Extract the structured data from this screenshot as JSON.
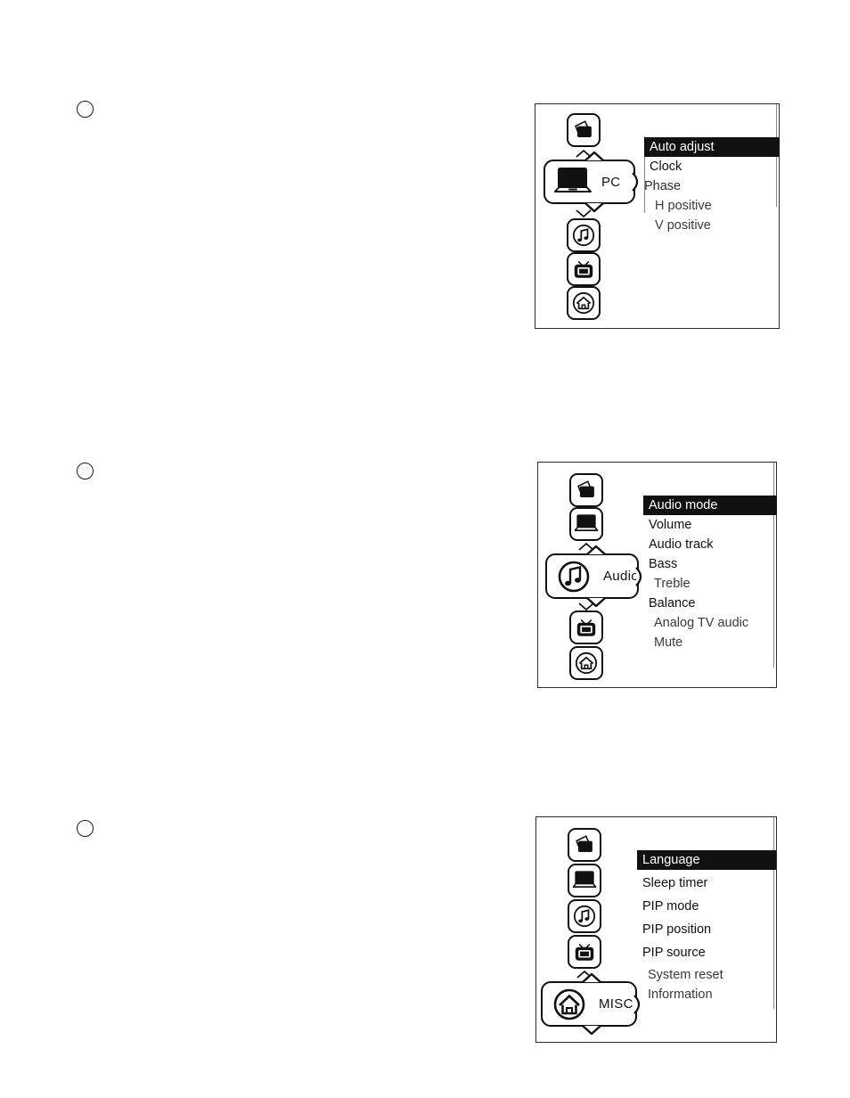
{
  "page": {
    "background_color": "#ffffff",
    "ink_color": "#111111",
    "highlight_bg": "#111111",
    "highlight_fg": "#ffffff"
  },
  "bullets": [
    {
      "name": "step-bullet-1"
    },
    {
      "name": "step-bullet-2"
    },
    {
      "name": "step-bullet-3"
    }
  ],
  "panels": [
    {
      "id": "pc-menu",
      "selected_category": "PC",
      "selected_icon": "laptop-icon",
      "rail_icons": [
        {
          "icon": "picture-icon",
          "label": "Picture"
        },
        {
          "icon": "music-note-icon",
          "label": "Audio"
        },
        {
          "icon": "tv-icon",
          "label": "TV"
        },
        {
          "icon": "home-icon",
          "label": "MISC"
        }
      ],
      "items": [
        {
          "label": "Auto adjust",
          "selected": true,
          "indent": false
        },
        {
          "label": "Clock",
          "selected": false,
          "indent": false
        },
        {
          "label": "Phase",
          "selected": false,
          "indent": false
        },
        {
          "label": "H positive",
          "selected": false,
          "indent": true
        },
        {
          "label": "V positive",
          "selected": false,
          "indent": true
        }
      ]
    },
    {
      "id": "audio-menu",
      "selected_category": "Audio",
      "selected_icon": "music-note-icon",
      "rail_icons": [
        {
          "icon": "picture-icon",
          "label": "Picture"
        },
        {
          "icon": "laptop-icon",
          "label": "PC"
        },
        {
          "icon": "tv-icon",
          "label": "TV"
        },
        {
          "icon": "home-icon",
          "label": "MISC"
        }
      ],
      "items": [
        {
          "label": "Audio mode",
          "selected": true,
          "indent": false
        },
        {
          "label": "Volume",
          "selected": false,
          "indent": false
        },
        {
          "label": "Audio track",
          "selected": false,
          "indent": false
        },
        {
          "label": "Bass",
          "selected": false,
          "indent": false
        },
        {
          "label": "Treble",
          "selected": false,
          "indent": true
        },
        {
          "label": "Balance",
          "selected": false,
          "indent": false
        },
        {
          "label": "Analog TV audic",
          "selected": false,
          "indent": true
        },
        {
          "label": "Mute",
          "selected": false,
          "indent": true
        }
      ]
    },
    {
      "id": "misc-menu",
      "selected_category": "MISC",
      "selected_icon": "home-icon",
      "rail_icons": [
        {
          "icon": "picture-icon",
          "label": "Picture"
        },
        {
          "icon": "laptop-icon",
          "label": "PC"
        },
        {
          "icon": "music-note-icon",
          "label": "Audio"
        },
        {
          "icon": "tv-icon",
          "label": "TV"
        }
      ],
      "items": [
        {
          "label": "Language",
          "selected": true,
          "indent": false
        },
        {
          "label": "Sleep timer",
          "selected": false,
          "indent": false
        },
        {
          "label": "PIP mode",
          "selected": false,
          "indent": false
        },
        {
          "label": "PIP position",
          "selected": false,
          "indent": false
        },
        {
          "label": "PIP source",
          "selected": false,
          "indent": false
        },
        {
          "label": "System reset",
          "selected": false,
          "indent": true
        },
        {
          "label": "Information",
          "selected": false,
          "indent": true
        }
      ]
    }
  ]
}
